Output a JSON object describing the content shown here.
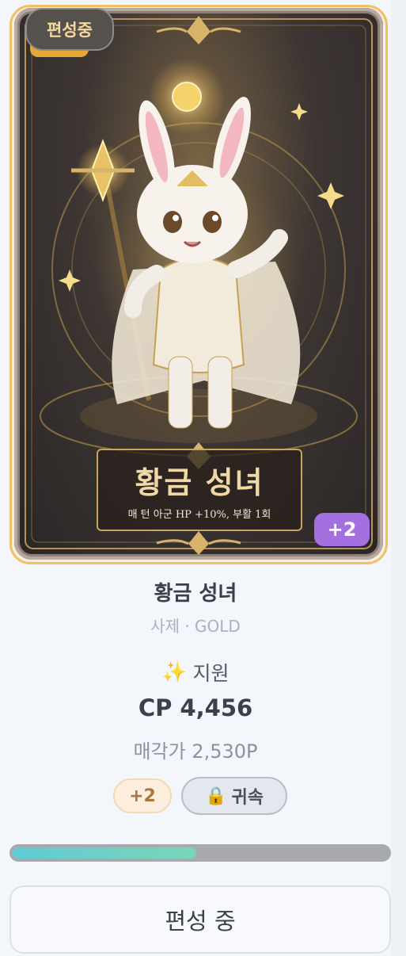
{
  "card": {
    "status_badge": "편성중",
    "title": "황금 성녀",
    "skill_desc": "매 턴 아군 HP +10%, 부활 1회",
    "enhance": "+2"
  },
  "info": {
    "name": "황금 성녀",
    "subtitle": "사제 · GOLD",
    "role_icon": "✨",
    "role_label": "지원",
    "cp": "CP 4,456",
    "sell_price": "매각가 2,530P"
  },
  "chips": {
    "enhance": "+2",
    "lock_icon": "🔒",
    "lock_label": "귀속"
  },
  "progress": {
    "value": 0.49
  },
  "actions": {
    "edit_button": "편성 중"
  },
  "colors": {
    "card_border": "#f2be66",
    "badge_purple": "#a470e0",
    "progress_fill": "#5fcbd6"
  }
}
